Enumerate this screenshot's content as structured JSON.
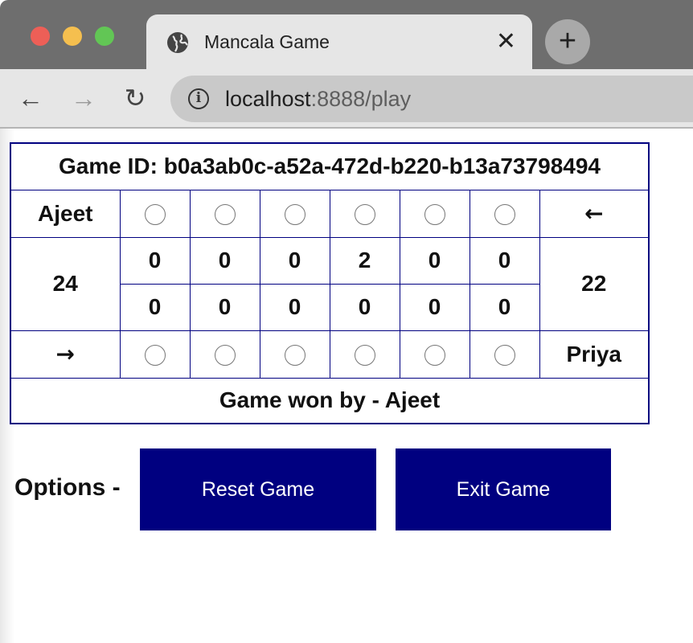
{
  "browser": {
    "tab_title": "Mancala Game",
    "tab_close": "✕",
    "new_tab": "+",
    "url_host": "localhost",
    "url_rest": ":8888/play",
    "back": "←",
    "forward": "→",
    "reload": "↻",
    "info": "i"
  },
  "game": {
    "title": "Game ID: b0a3ab0c-a52a-472d-b220-b13a73798494",
    "top_player": "Ajeet",
    "top_arrow": "←",
    "bottom_player": "Priya",
    "bottom_arrow": "→",
    "left_store": "24",
    "right_store": "22",
    "top_pits": [
      "0",
      "0",
      "0",
      "2",
      "0",
      "0"
    ],
    "bottom_pits": [
      "0",
      "0",
      "0",
      "0",
      "0",
      "0"
    ],
    "result": "Game won by - Ajeet"
  },
  "options": {
    "label": "Options -",
    "reset_label": "Reset Game",
    "exit_label": "Exit Game"
  },
  "colors": {
    "accent": "#000080"
  },
  "icons": [
    "globe-icon",
    "close-icon",
    "plus-icon",
    "back-arrow-icon",
    "forward-arrow-icon",
    "reload-icon",
    "info-icon"
  ]
}
